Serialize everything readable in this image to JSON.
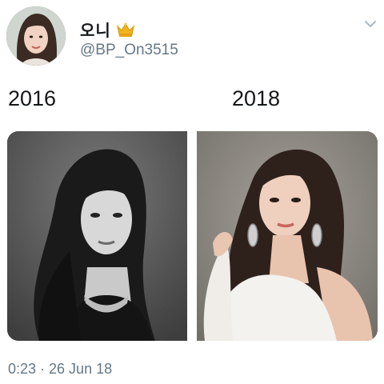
{
  "tweet": {
    "display_name": "오니",
    "handle": "@BP_On3515",
    "avatar_icon": "user-avatar-photo",
    "badge_icon": "crown-icon",
    "menu_icon": "chevron-down-icon",
    "captions": {
      "left_year": "2016",
      "right_year": "2018"
    },
    "photos": {
      "left": "black-and-white portrait photo",
      "right": "color portrait photo in white off-shoulder top"
    },
    "timestamp": "0:23 · 26 Jun 18"
  },
  "colors": {
    "text": "#14171a",
    "secondary_text": "#657786",
    "crown": "#f2b41c",
    "background": "#ffffff"
  }
}
